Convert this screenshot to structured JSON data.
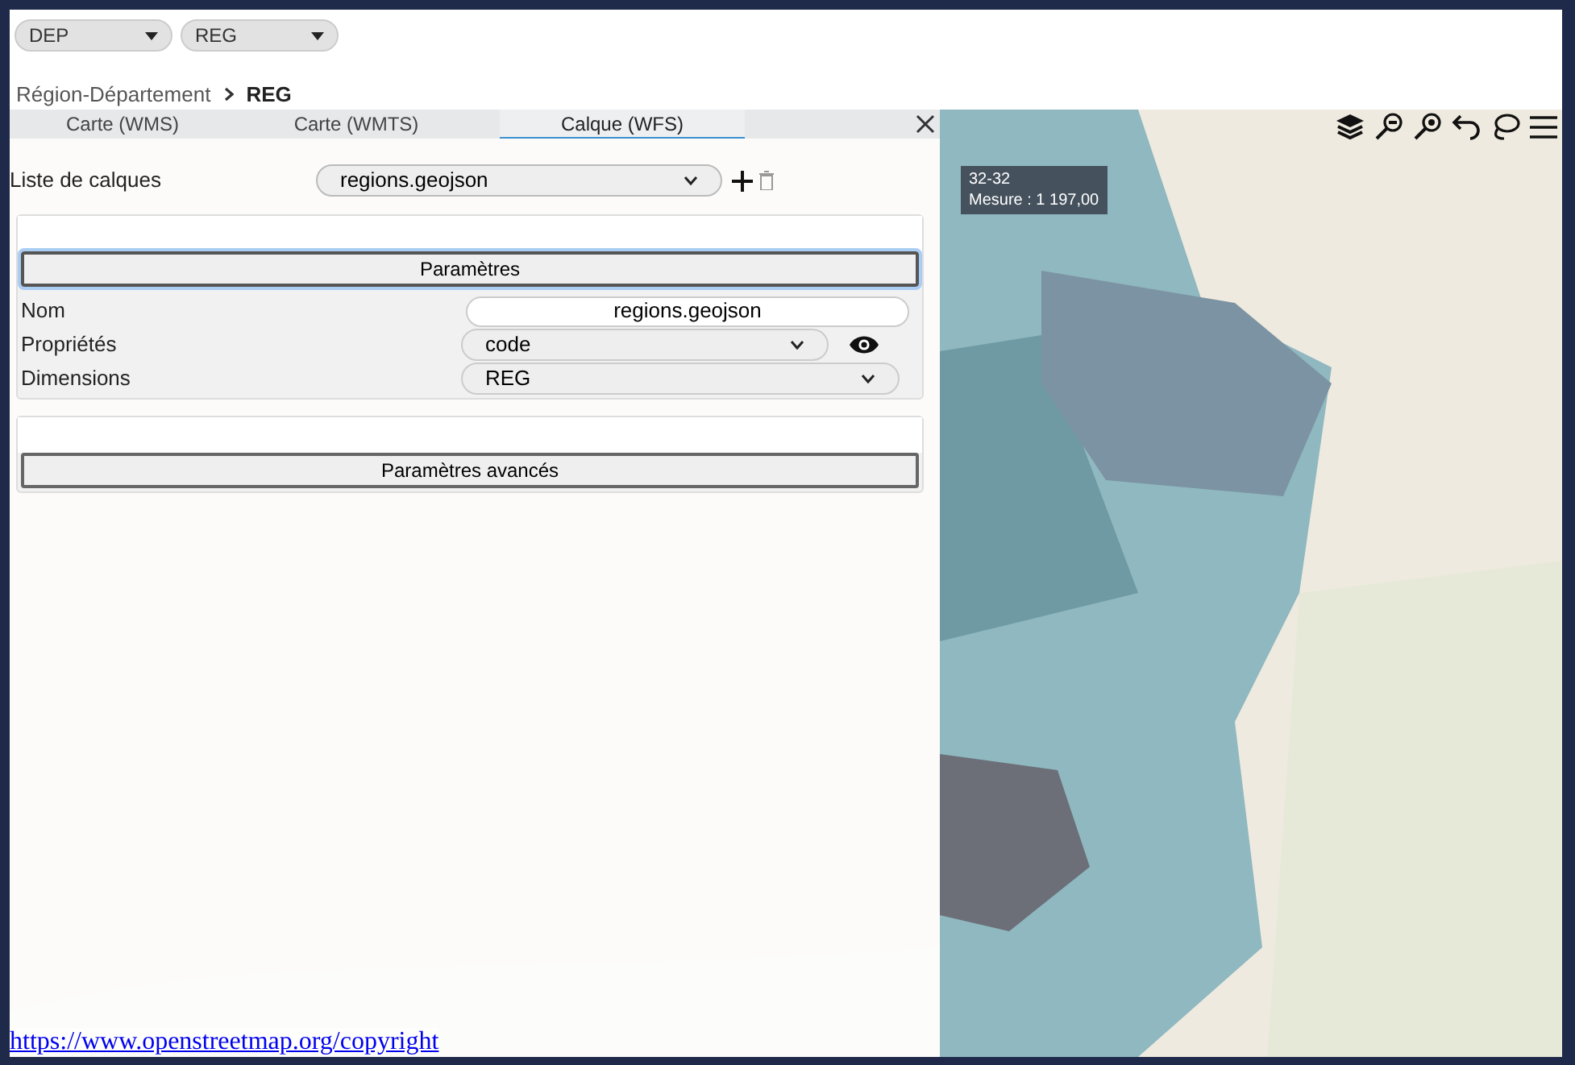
{
  "filters": [
    {
      "value": "DEP"
    },
    {
      "value": "REG"
    }
  ],
  "breadcrumb": {
    "items": [
      "Région-Département"
    ],
    "current": "REG"
  },
  "tabs": [
    {
      "label": "Carte (WMS)",
      "selected": false
    },
    {
      "label": "Carte (WMTS)",
      "selected": false
    },
    {
      "label": "Calque (WFS)",
      "selected": true
    }
  ],
  "layer_list": {
    "label": "Liste de calques",
    "value": "regions.geojson"
  },
  "sections": [
    {
      "title": "Paramètres",
      "expanded": true,
      "fields": [
        {
          "kind": "text",
          "label": "Nom",
          "value": "regions.geojson"
        },
        {
          "kind": "select_toggle",
          "label": "Propriétés",
          "value": "code"
        },
        {
          "kind": "select",
          "label": "Dimensions",
          "value": "REG"
        }
      ]
    },
    {
      "title": "Paramètres avancés",
      "expanded": false
    }
  ],
  "tooltip": {
    "title": "32-32",
    "measure": "Mesure : 1 197,00"
  },
  "attribution": "https://www.openstreetmap.org/copyright"
}
